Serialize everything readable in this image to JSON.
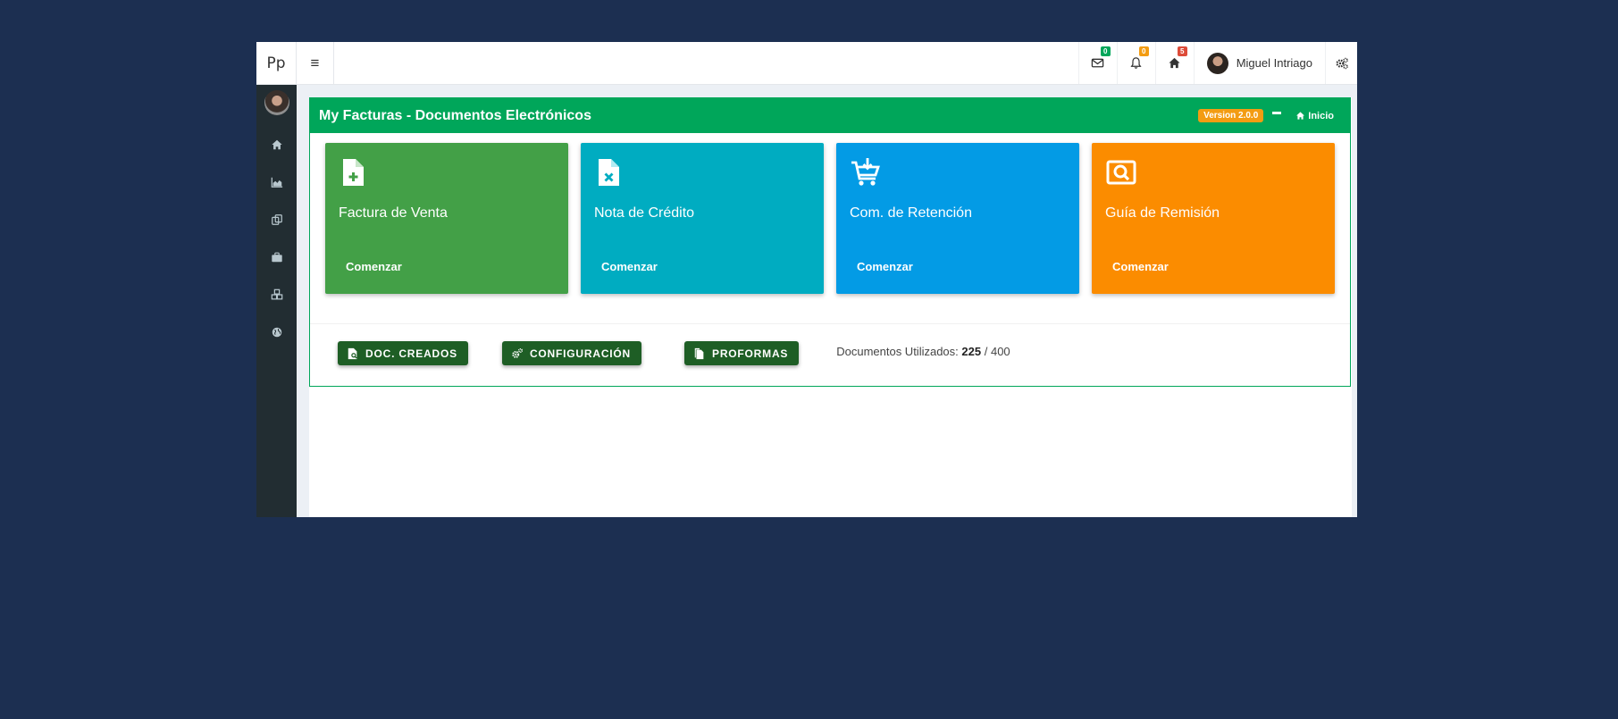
{
  "topbar": {
    "brand": "Pp",
    "hamburger": "≡",
    "mail_badge": "0",
    "bell_badge": "0",
    "home_badge": "5",
    "user_name": "Miguel Intriago",
    "colors": {
      "mail_badge": "#00a65a",
      "bell_badge": "#f39c12",
      "home_badge": "#dd4b39"
    }
  },
  "sidebar": {
    "items": [
      {
        "icon": "home-icon"
      },
      {
        "icon": "area-chart-icon"
      },
      {
        "icon": "copy-icon"
      },
      {
        "icon": "briefcase-icon"
      },
      {
        "icon": "cubes-icon"
      },
      {
        "icon": "globe-icon"
      }
    ]
  },
  "box": {
    "title": "My Facturas - Documentos Electrónicos",
    "version": "Version 2.0.0",
    "inicio": "Inicio",
    "header_color": "#00a65a"
  },
  "cards": [
    {
      "title": "Factura de Venta",
      "cta": "Comenzar",
      "color": "#43a047",
      "icon": "file-plus-icon"
    },
    {
      "title": "Nota de Crédito",
      "cta": "Comenzar",
      "color": "#00acc1",
      "icon": "file-x-icon"
    },
    {
      "title": "Com. de Retención",
      "cta": "Comenzar",
      "color": "#039be5",
      "icon": "cart-download-icon"
    },
    {
      "title": "Guía de Remisión",
      "cta": "Comenzar",
      "color": "#fb8c00",
      "icon": "search-box-icon"
    }
  ],
  "actions": {
    "doc_creados": "DOC. CREADOS",
    "configuracion": "CONFIGURACIÓN",
    "proformas": "PROFORMAS",
    "docs_label": "Documentos Utilizados:",
    "docs_used": "225",
    "docs_total": "/ 400"
  }
}
